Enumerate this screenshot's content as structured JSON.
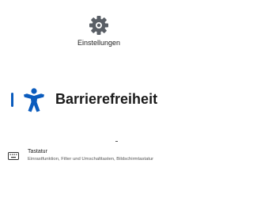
{
  "header": {
    "app_icon": "gear-icon",
    "app_title": "Einstellungen"
  },
  "page": {
    "icon": "accessibility-icon",
    "title": "Barrierefreiheit",
    "accent_color": "#0a5bbd"
  },
  "items": [
    {
      "icon": "keyboard-icon",
      "title": "Tastatur",
      "description": "Einrastfunktion, Filter und Umschalttasten, Bildschirmtastatur"
    }
  ]
}
